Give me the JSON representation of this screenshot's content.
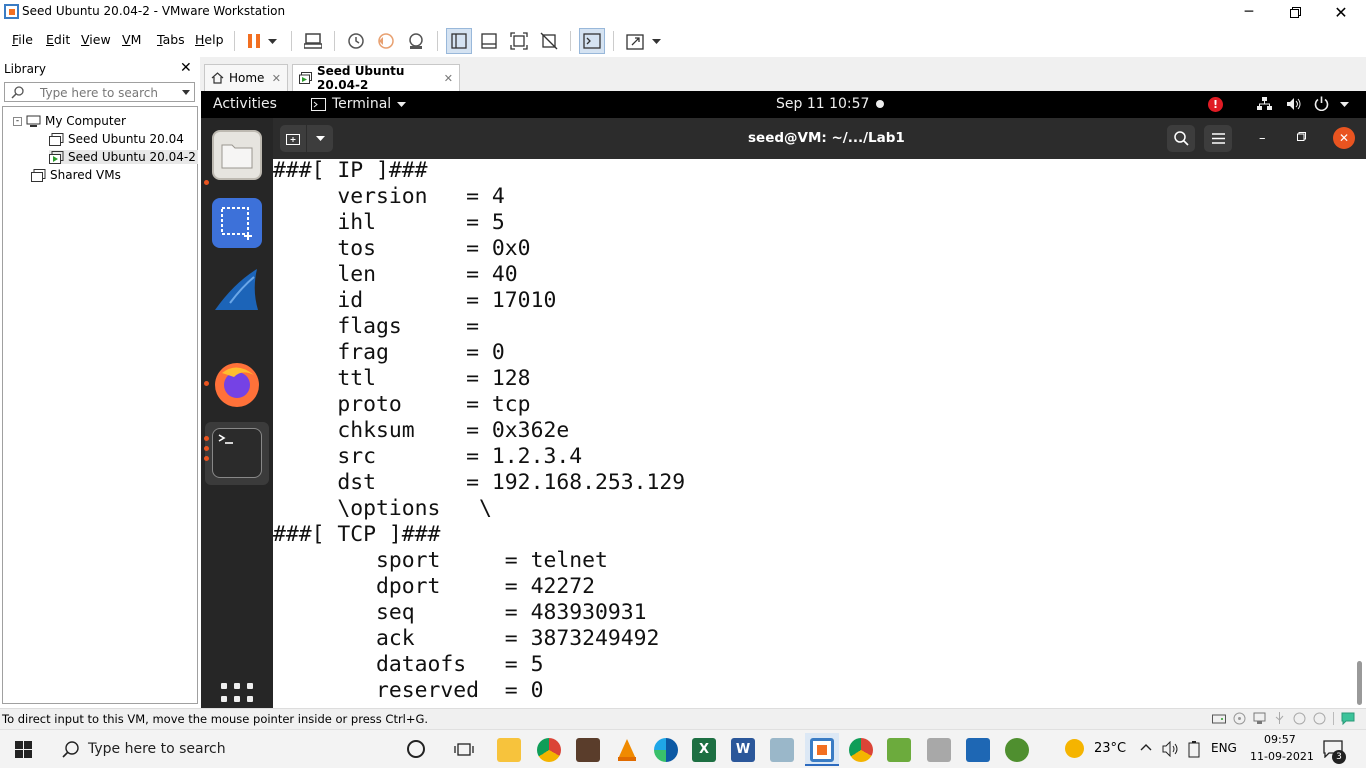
{
  "window": {
    "title": "Seed Ubuntu 20.04-2 - VMware Workstation"
  },
  "menubar": {
    "items": [
      "File",
      "Edit",
      "View",
      "VM",
      "Tabs",
      "Help"
    ],
    "underline": [
      "F",
      "E",
      "V",
      "V",
      "T",
      "H"
    ]
  },
  "library": {
    "title": "Library",
    "search_placeholder": "Type here to search",
    "tree": {
      "root": "My Computer",
      "vm1": "Seed Ubuntu 20.04",
      "vm2": "Seed Ubuntu 20.04-2",
      "shared": "Shared VMs"
    }
  },
  "tabs": {
    "home": "Home",
    "vm": "Seed Ubuntu 20.04-2"
  },
  "gnome": {
    "activities": "Activities",
    "app": "Terminal",
    "datetime": "Sep 11  10:57"
  },
  "terminal": {
    "title": "seed@VM: ~/.../Lab1",
    "lines": [
      "###[ IP ]###",
      "     version   = 4",
      "     ihl       = 5",
      "     tos       = 0x0",
      "     len       = 40",
      "     id        = 17010",
      "     flags     = ",
      "     frag      = 0",
      "     ttl       = 128",
      "     proto     = tcp",
      "     chksum    = 0x362e",
      "     src       = 1.2.3.4",
      "     dst       = 192.168.253.129",
      "     \\options   \\",
      "###[ TCP ]###",
      "        sport     = telnet",
      "        dport     = 42272",
      "        seq       = 483930931",
      "        ack       = 3873249492",
      "        dataofs   = 5",
      "        reserved  = 0"
    ]
  },
  "statusbar": {
    "text": "To direct input to this VM, move the mouse pointer inside or press Ctrl+G."
  },
  "taskbar": {
    "search_placeholder": "Type here to search",
    "weather": "23°C",
    "lang": "ENG",
    "time": "09:57",
    "date": "11-09-2021",
    "notif_count": "3"
  },
  "colors": {
    "ubuntu_orange": "#e95420",
    "vmware_pause": "#f26f21",
    "terminal_bg": "#ffffff",
    "dock_bg": "#262626"
  }
}
